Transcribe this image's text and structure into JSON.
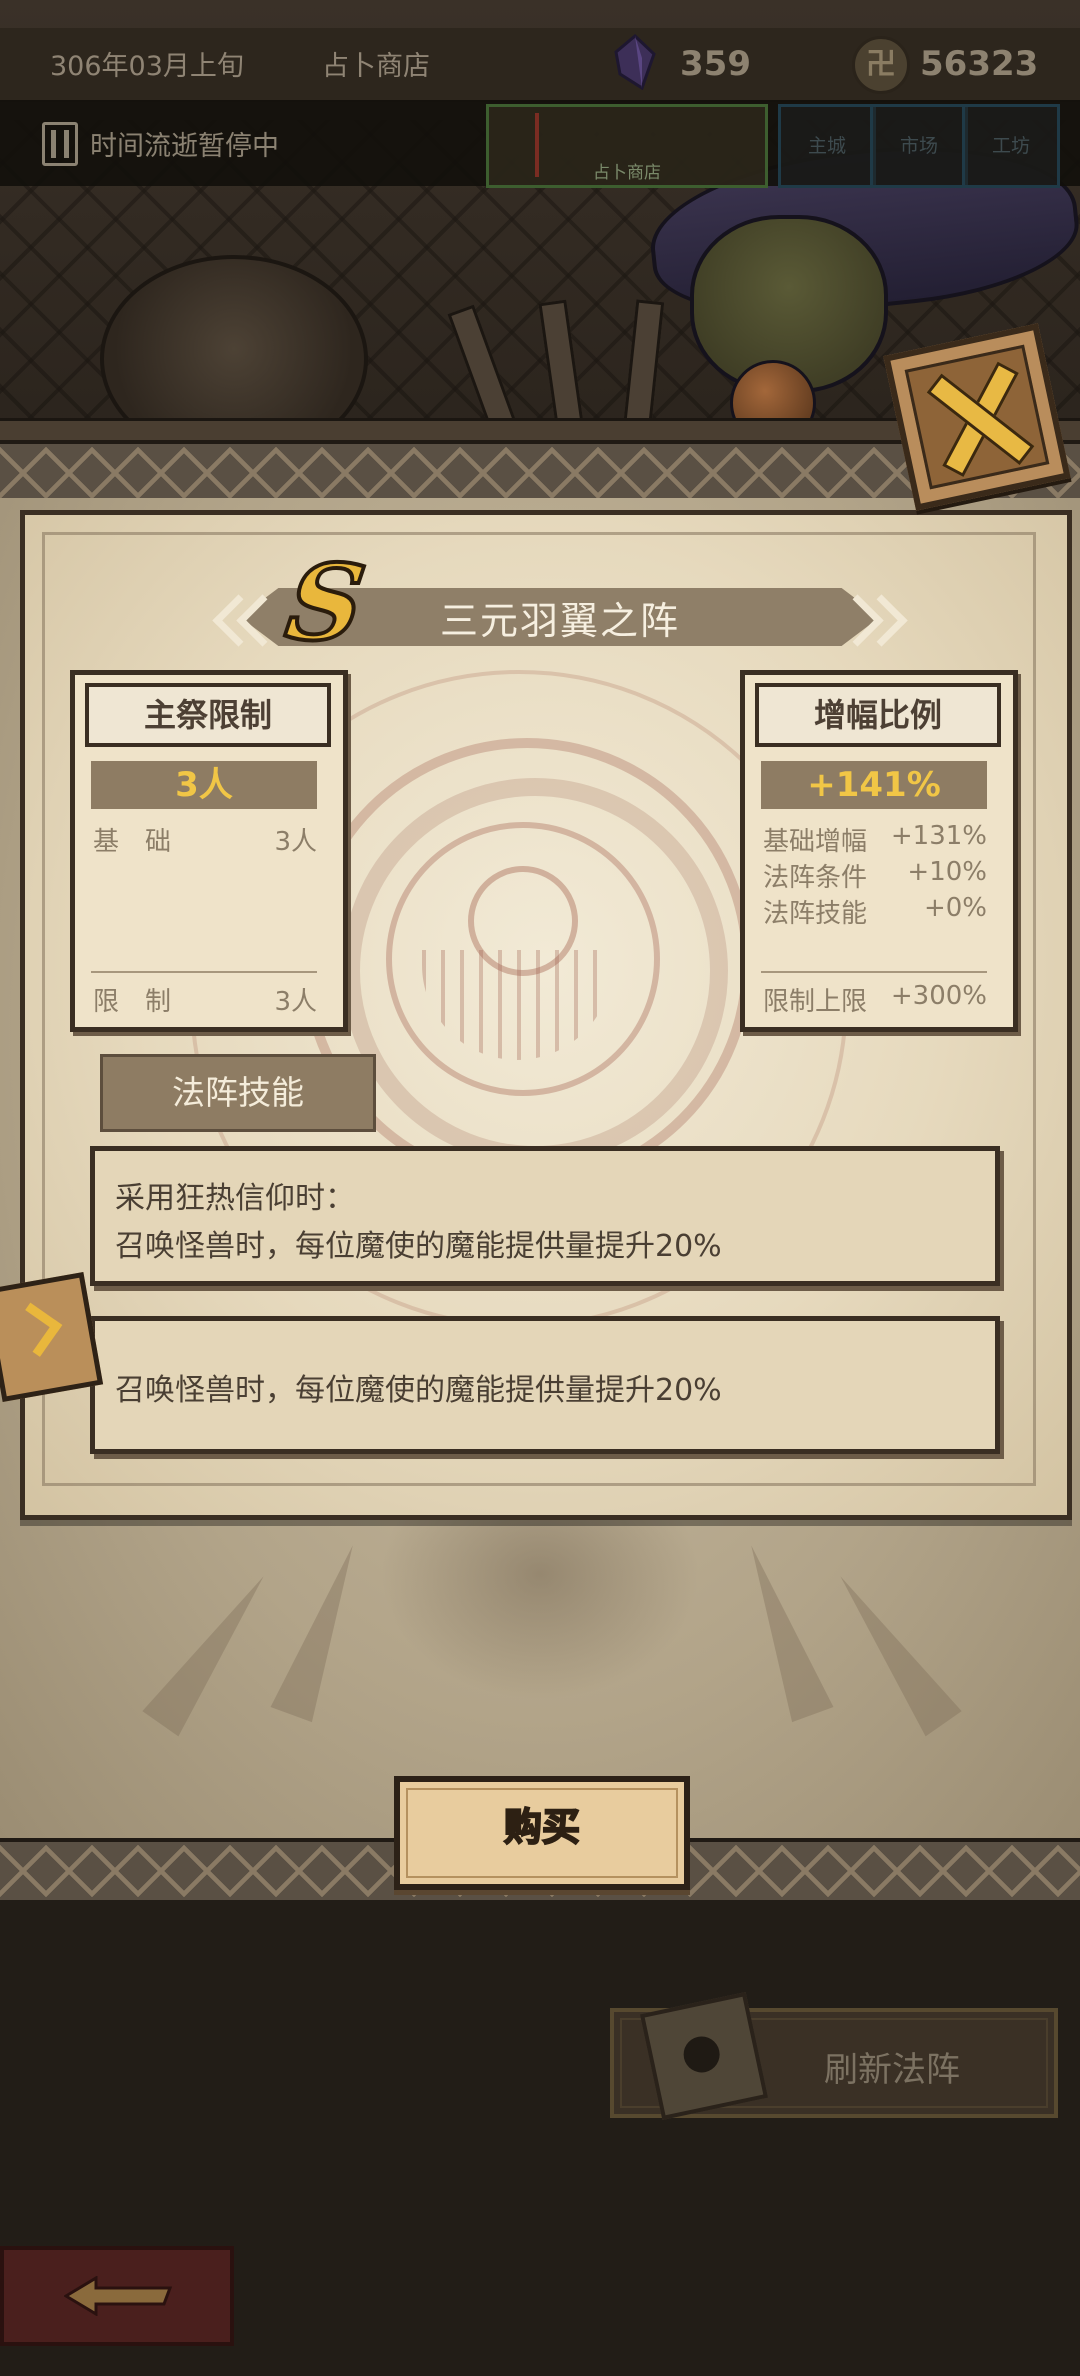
{
  "hud": {
    "date": "306年03月上旬",
    "location": "占卜商店",
    "gems": "359",
    "coins": "56323",
    "coin_icon_glyph": "卍",
    "time_status": "时间流逝暂停中",
    "tabs": {
      "shop_label": "占卜商店",
      "slot1": "主城",
      "slot2": "市场",
      "slot3": "工坊"
    }
  },
  "panel": {
    "title": "三元羽翼之阵",
    "grade": "S",
    "host_limit": {
      "header": "主祭限制",
      "value": "3人",
      "rows": [
        {
          "label": "基　础",
          "value": "3人"
        }
      ],
      "limit_label": "限　制",
      "limit_value": "3人"
    },
    "amplify": {
      "header": "增幅比例",
      "value": "+141%",
      "rows": [
        {
          "label": "基础增幅",
          "value": "+131%"
        },
        {
          "label": "法阵条件",
          "value": "+10%"
        },
        {
          "label": "法阵技能",
          "value": "+0%"
        }
      ],
      "limit_label": "限制上限",
      "limit_value": "+300%"
    },
    "skills_label": "法阵技能",
    "skill1": {
      "line1": "采用狂热信仰时：",
      "line2": "召唤怪兽时，每位魔使的魔能提供量提升20%"
    },
    "skill2": {
      "line1": "召唤怪兽时，每位魔使的魔能提供量提升20%"
    }
  },
  "buttons": {
    "buy": "购买",
    "refresh": "刷新法阵",
    "back_icon": "back-arrow-icon",
    "close_icon": "close-x-icon"
  },
  "colors": {
    "accent_gold": "#e9b73c",
    "parchment": "#e6d9bd",
    "ink": "#3a2e22"
  }
}
